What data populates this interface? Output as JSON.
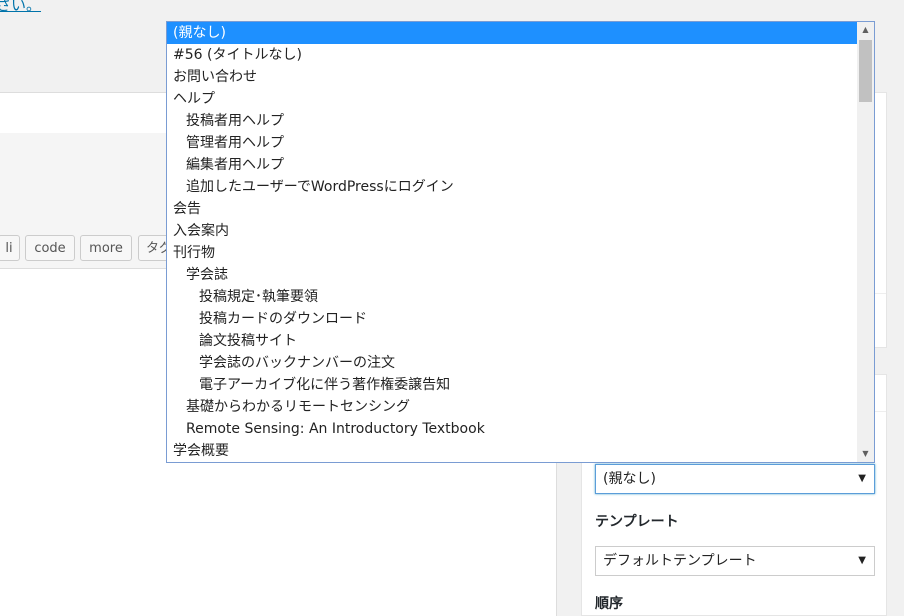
{
  "notice": {
    "link_text": "さい。"
  },
  "editor": {
    "quicktags": [
      "li",
      "code",
      "more",
      "タグ"
    ]
  },
  "page_attributes": {
    "parent_selected": "(親なし)",
    "template_label": "テンプレート",
    "template_selected": "デフォルトテンプレート",
    "order_label": "順序"
  },
  "parent_dropdown": {
    "options": [
      {
        "label": "(親なし)",
        "level": 0,
        "selected": true
      },
      {
        "label": "#56 (タイトルなし)",
        "level": 0
      },
      {
        "label": "お問い合わせ",
        "level": 0
      },
      {
        "label": "ヘルプ",
        "level": 0
      },
      {
        "label": "投稿者用ヘルプ",
        "level": 1
      },
      {
        "label": "管理者用ヘルプ",
        "level": 1
      },
      {
        "label": "編集者用ヘルプ",
        "level": 1
      },
      {
        "label": "追加したユーザーでWordPressにログイン",
        "level": 1
      },
      {
        "label": "会告",
        "level": 0
      },
      {
        "label": "入会案内",
        "level": 0
      },
      {
        "label": "刊行物",
        "level": 0
      },
      {
        "label": "学会誌",
        "level": 1
      },
      {
        "label": "投稿規定･執筆要領",
        "level": 2
      },
      {
        "label": "投稿カードのダウンロード",
        "level": 2
      },
      {
        "label": "論文投稿サイト",
        "level": 2
      },
      {
        "label": "学会誌のバックナンバーの注文",
        "level": 2
      },
      {
        "label": "電子アーカイブ化に伴う著作権委譲告知",
        "level": 2
      },
      {
        "label": "基礎からわかるリモートセンシング",
        "level": 1
      },
      {
        "label": "Remote Sensing: An Introductory Textbook",
        "level": 1
      },
      {
        "label": "学会概要",
        "level": 0
      }
    ]
  }
}
